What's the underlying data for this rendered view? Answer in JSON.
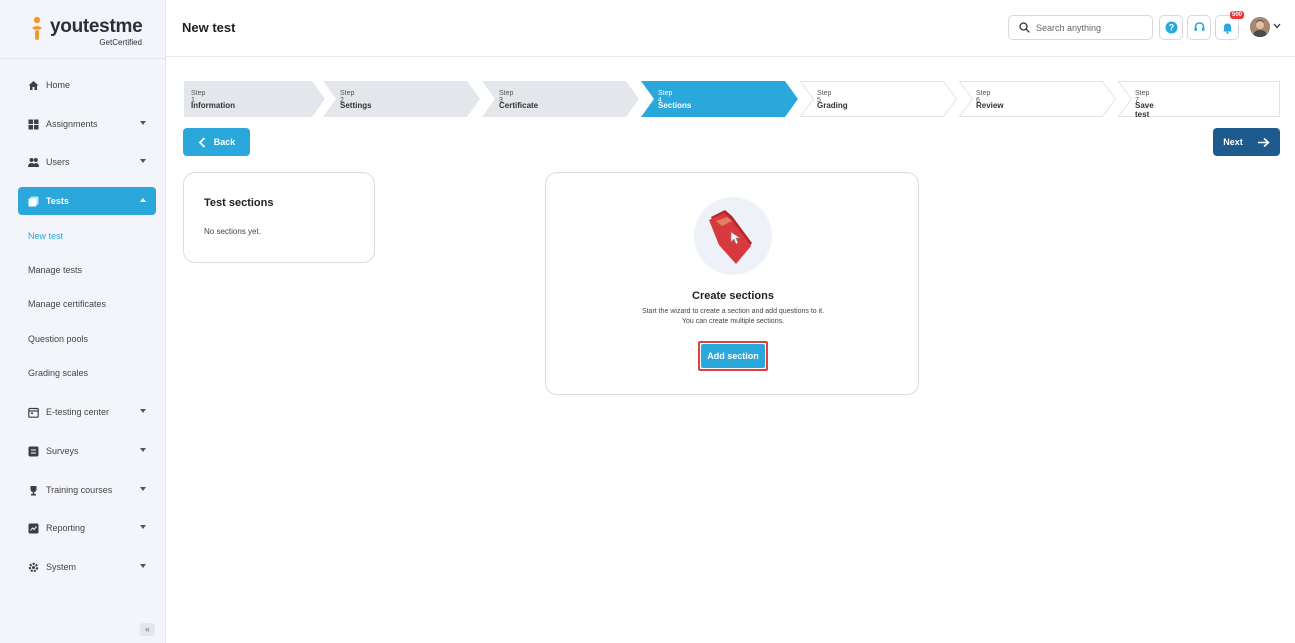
{
  "brand": {
    "name_prefix": "youtest",
    "name_suffix": "me",
    "tagline": "GetCertified"
  },
  "sidebar": {
    "items": [
      {
        "label": "Home",
        "icon": "home-icon"
      },
      {
        "label": "Assignments",
        "icon": "assignments-icon"
      },
      {
        "label": "Users",
        "icon": "users-icon"
      },
      {
        "label": "Tests",
        "icon": "tests-icon"
      },
      {
        "label": "E-testing center",
        "icon": "calendar-icon"
      },
      {
        "label": "Surveys",
        "icon": "survey-icon"
      },
      {
        "label": "Training courses",
        "icon": "trophy-icon"
      },
      {
        "label": "Reporting",
        "icon": "reporting-icon"
      },
      {
        "label": "System",
        "icon": "gear-icon"
      }
    ],
    "tests_submenu": [
      "New test",
      "Manage tests",
      "Manage certificates",
      "Question pools",
      "Grading scales"
    ],
    "collapse_label": "«"
  },
  "header": {
    "title": "New test",
    "search_placeholder": "Search anything",
    "notification_count": "500"
  },
  "stepper": {
    "steps": [
      {
        "num": "Step 1",
        "label": "Information"
      },
      {
        "num": "Step 2",
        "label": "Settings"
      },
      {
        "num": "Step 3",
        "label": "Certificate"
      },
      {
        "num": "Step 4",
        "label": "Sections"
      },
      {
        "num": "Step 5",
        "label": "Grading"
      },
      {
        "num": "Step 6",
        "label": "Review"
      },
      {
        "num": "Step 7",
        "label": "Save test"
      }
    ],
    "active_index": 3
  },
  "actions": {
    "back": "Back",
    "next": "Next"
  },
  "sections_card": {
    "title": "Test sections",
    "empty": "No sections yet."
  },
  "create_card": {
    "title": "Create sections",
    "desc_line1": "Start the wizard to create a section and add questions to it.",
    "desc_line2": "You can create multiple sections.",
    "button": "Add section"
  },
  "colors": {
    "accent": "#2aa8dc",
    "next": "#1d5a8e",
    "highlight": "#d9443c"
  }
}
